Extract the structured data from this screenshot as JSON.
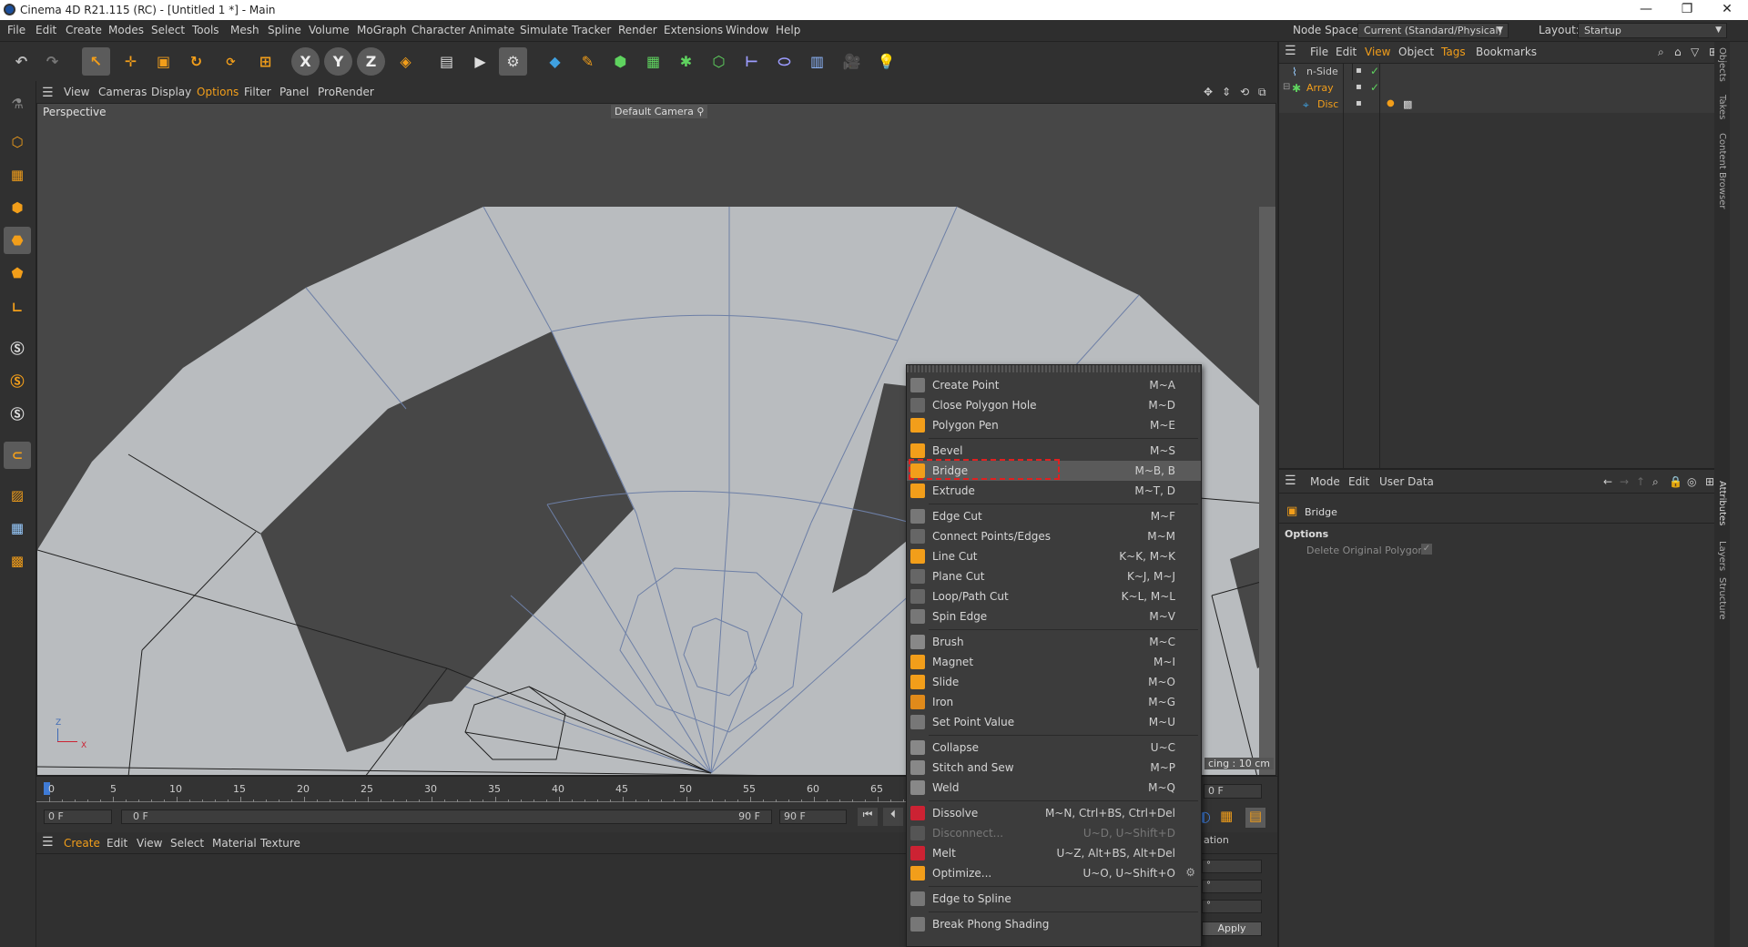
{
  "titlebar": {
    "title": "Cinema 4D R21.115 (RC) - [Untitled 1 *] - Main",
    "minimize": "—",
    "restore": "❐",
    "close": "✕"
  },
  "menubar": {
    "items": [
      "File",
      "Edit",
      "Create",
      "Modes",
      "Select",
      "Tools",
      "Mesh",
      "Spline",
      "Volume",
      "MoGraph",
      "Character",
      "Animate",
      "Simulate",
      "Tracker",
      "Render",
      "Extensions",
      "Window",
      "Help"
    ],
    "node_space_label": "Node Space:",
    "node_space_value": "Current (Standard/Physical)",
    "layout_label": "Layout:",
    "layout_value": "Startup"
  },
  "toolbar": {
    "axis_x": "X",
    "axis_y": "Y",
    "axis_z": "Z"
  },
  "viewport": {
    "menu": [
      "View",
      "Cameras",
      "Display",
      "Options",
      "Filter",
      "Panel",
      "ProRender"
    ],
    "label": "Perspective",
    "camera": "Default Camera",
    "grid_spacing": "cing : 10 cm",
    "axis_z": "Z",
    "axis_x": "X"
  },
  "timeline": {
    "ticks": [
      "0",
      "5",
      "10",
      "15",
      "20",
      "25",
      "30",
      "35",
      "40",
      "45",
      "50",
      "55",
      "60",
      "65"
    ],
    "current_frame": "0 F",
    "range_start": "0 F",
    "range_end_in": "90 F",
    "range_end": "90 F",
    "right_frame": "0 F"
  },
  "material": {
    "menu": [
      "Create",
      "Edit",
      "View",
      "Select",
      "Material",
      "Texture"
    ]
  },
  "objects": {
    "menu": [
      "File",
      "Edit",
      "View",
      "Object",
      "Tags",
      "Bookmarks"
    ],
    "rows": [
      {
        "name": "n-Side"
      },
      {
        "name": "Array"
      },
      {
        "name": "Disc"
      }
    ]
  },
  "attributes": {
    "menu": [
      "Mode",
      "Edit",
      "User Data"
    ],
    "title": "Bridge",
    "section": "Options",
    "option": "Delete Original Polygons",
    "coords_label": "ation",
    "apply": "Apply",
    "deg1": "°",
    "deg2": "°",
    "deg3": "°"
  },
  "side_tabs": [
    "Objects",
    "Takes",
    "Content Browser",
    "Attributes",
    "Layers",
    "Structure"
  ],
  "context_menu": {
    "items": [
      {
        "label": "Create Point",
        "shortcut": "M~A"
      },
      {
        "label": "Close Polygon Hole",
        "shortcut": "M~D"
      },
      {
        "label": "Polygon Pen",
        "shortcut": "M~E"
      },
      {
        "label": "Bevel",
        "shortcut": "M~S"
      },
      {
        "label": "Bridge",
        "shortcut": "M~B, B"
      },
      {
        "label": "Extrude",
        "shortcut": "M~T, D"
      },
      {
        "label": "Edge Cut",
        "shortcut": "M~F"
      },
      {
        "label": "Connect Points/Edges",
        "shortcut": "M~M"
      },
      {
        "label": "Line Cut",
        "shortcut": "K~K, M~K"
      },
      {
        "label": "Plane Cut",
        "shortcut": "K~J, M~J"
      },
      {
        "label": "Loop/Path Cut",
        "shortcut": "K~L, M~L"
      },
      {
        "label": "Spin Edge",
        "shortcut": "M~V"
      },
      {
        "label": "Brush",
        "shortcut": "M~C"
      },
      {
        "label": "Magnet",
        "shortcut": "M~I"
      },
      {
        "label": "Slide",
        "shortcut": "M~O"
      },
      {
        "label": "Iron",
        "shortcut": "M~G"
      },
      {
        "label": "Set Point Value",
        "shortcut": "M~U"
      },
      {
        "label": "Collapse",
        "shortcut": "U~C"
      },
      {
        "label": "Stitch and Sew",
        "shortcut": "M~P"
      },
      {
        "label": "Weld",
        "shortcut": "M~Q"
      },
      {
        "label": "Dissolve",
        "shortcut": "M~N, Ctrl+BS, Ctrl+Del"
      },
      {
        "label": "Disconnect...",
        "shortcut": "U~D, U~Shift+D"
      },
      {
        "label": "Melt",
        "shortcut": "U~Z, Alt+BS, Alt+Del"
      },
      {
        "label": "Optimize...",
        "shortcut": "U~O, U~Shift+O"
      },
      {
        "label": "Edge to Spline",
        "shortcut": ""
      },
      {
        "label": "Break Phong Shading",
        "shortcut": ""
      }
    ]
  },
  "colors": {
    "accent": "#f29e1a",
    "highlight_box": "#e02020",
    "menu_bg": "#3c3c3c",
    "panel_bg": "#333333"
  }
}
